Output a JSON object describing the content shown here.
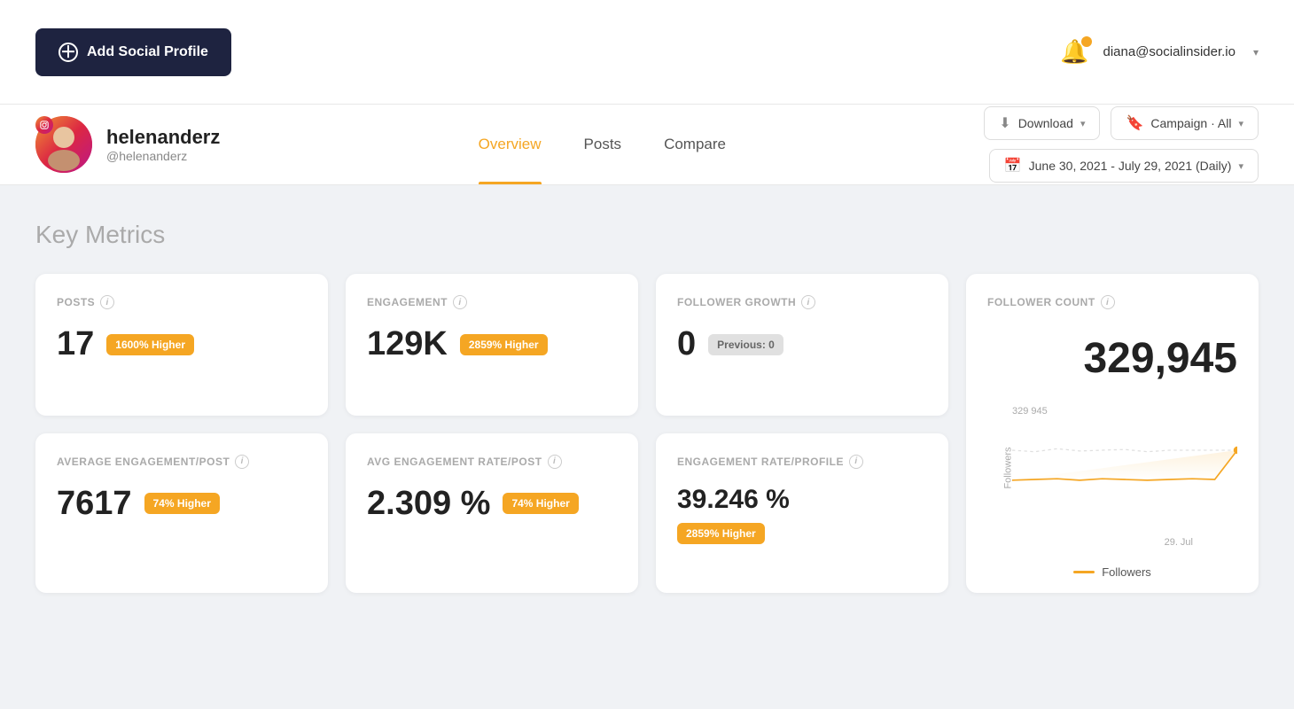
{
  "topbar": {
    "add_profile_label": "Add Social Profile",
    "user_email": "diana@socialinsider.io"
  },
  "profile": {
    "name": "helenanderz",
    "handle": "@helenanderz",
    "ig_icon": "📷"
  },
  "nav": {
    "tabs": [
      {
        "label": "Overview",
        "active": true
      },
      {
        "label": "Posts",
        "active": false
      },
      {
        "label": "Compare",
        "active": false
      }
    ]
  },
  "actions": {
    "download_label": "Download",
    "campaign_label": "Campaign · All",
    "date_range_label": "June 30, 2021 - July 29, 2021 (Daily)"
  },
  "key_metrics": {
    "section_title": "Key Metrics",
    "cards": [
      {
        "label": "POSTS",
        "value": "17",
        "badge": "1600% Higher",
        "badge_type": "orange"
      },
      {
        "label": "ENGAGEMENT",
        "value": "129K",
        "badge": "2859% Higher",
        "badge_type": "orange"
      },
      {
        "label": "FOLLOWER GROWTH",
        "value": "0",
        "badge": "Previous: 0",
        "badge_type": "grey"
      },
      {
        "label": "AVERAGE ENGAGEMENT/POST",
        "value": "7617",
        "badge": "74% Higher",
        "badge_type": "orange"
      },
      {
        "label": "AVG ENGAGEMENT RATE/POST",
        "value": "2.309 %",
        "badge": "74% Higher",
        "badge_type": "orange"
      },
      {
        "label": "ENGAGEMENT RATE/PROFILE",
        "value": "39.246 %",
        "badge": "2859% Higher",
        "badge_type": "orange"
      }
    ],
    "follower_count": {
      "label": "FOLLOWER COUNT",
      "value": "329,945",
      "chart_y_label": "Followers",
      "chart_value": "329 945",
      "chart_x_label": "29. Jul",
      "legend_label": "Followers"
    }
  }
}
